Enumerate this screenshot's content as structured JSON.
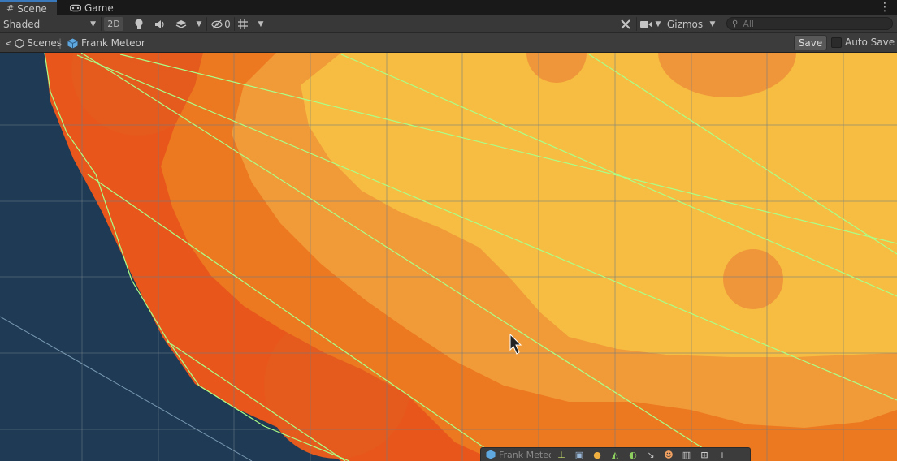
{
  "tabs": [
    {
      "label": "Scene",
      "icon": "hash-icon",
      "active": true
    },
    {
      "label": "Game",
      "icon": "gamepad-icon",
      "active": false
    }
  ],
  "toolbar": {
    "draw_mode": "Shaded",
    "mode_2d": "2D",
    "hidden_count": "0",
    "gizmos_label": "Gizmos",
    "search_placeholder": "All"
  },
  "breadcrumb": {
    "root": "Scenes",
    "prefab": "Frank Meteor"
  },
  "actions": {
    "save_label": "Save",
    "auto_save_label": "Auto Save",
    "auto_save_checked": false
  },
  "overlay": {
    "title": "Frank Meteor"
  },
  "colors": {
    "background_space": "#1f3a54",
    "meteor_outer": "#e8561c",
    "meteor_mid": "#ec7820",
    "meteor_inner": "#f19a38",
    "meteor_core": "#f6bd42",
    "crater": "#f0963a",
    "collider_outline": "#aaff88",
    "grid_line": "#6e7c86",
    "accent": "#3a79bb"
  }
}
